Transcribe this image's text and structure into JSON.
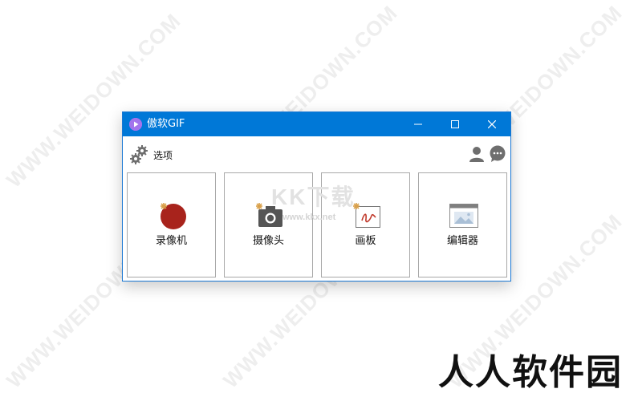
{
  "watermark": {
    "text": "WWW.WEIDOWN.COM"
  },
  "window": {
    "title": "傲软GIF",
    "controls": {
      "minimize": "minimize-icon",
      "maximize": "maximize-icon",
      "close": "close-icon"
    },
    "accent_color": "#0078d7"
  },
  "toolbar": {
    "options_label": "选项",
    "user_icon": "user-icon",
    "chat_icon": "chat-icon"
  },
  "modes": [
    {
      "label": "录像机",
      "icon": "recorder-icon",
      "color": "#a8231c"
    },
    {
      "label": "摄像头",
      "icon": "camera-icon",
      "color": "#555555"
    },
    {
      "label": "画板",
      "icon": "whiteboard-icon",
      "color": "#c0392b"
    },
    {
      "label": "编辑器",
      "icon": "editor-icon",
      "color": "#7f7f7f"
    }
  ],
  "overlay": {
    "kk_text": "KK下载",
    "kk_url": "www.kkx.net",
    "brand": "人人软件园"
  }
}
